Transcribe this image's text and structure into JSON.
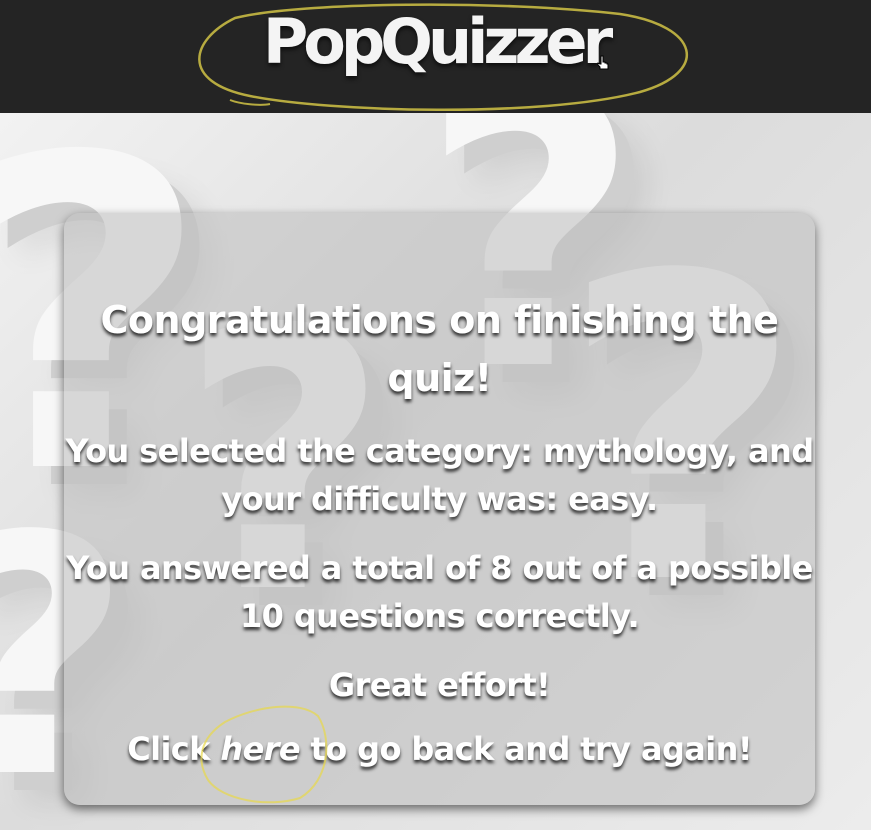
{
  "header": {
    "logo_text": "PopQuizzer"
  },
  "results": {
    "heading": "Congratulations on finishing the quiz!",
    "category_line": "You selected the category: mythology, and your difficulty was: easy.",
    "score_line": "You answered a total of 8 out of a possible 10 questions correctly.",
    "feedback": "Great effort!",
    "retry_prefix": "Click ",
    "retry_link": "here",
    "retry_suffix": " to go back and try again!"
  },
  "icons": {
    "background": "question-mark-pattern",
    "cursor": "hand-pointer-icon"
  },
  "colors": {
    "header_bg": "#242424",
    "annotation": "#e8d84a",
    "text": "#ffffff"
  }
}
